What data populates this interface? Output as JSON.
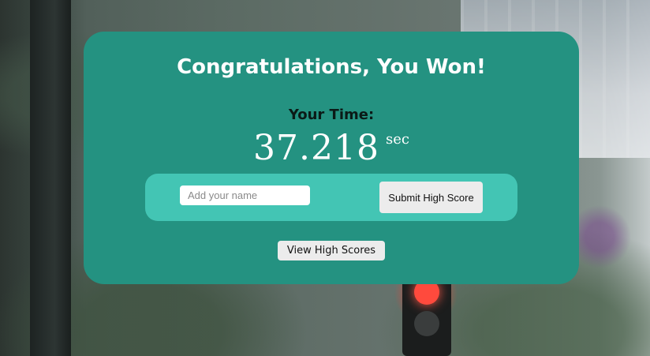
{
  "modal": {
    "title": "Congratulations, You Won!",
    "time_label": "Your Time:",
    "time_value": "37.218",
    "time_unit": "sec",
    "name_input": {
      "placeholder": "Add your name",
      "value": ""
    },
    "submit_label": "Submit High Score",
    "view_scores_label": "View High Scores"
  },
  "colors": {
    "modal_background": "#249281",
    "score_bar_background": "#43c5b4",
    "button_background": "#ececec"
  }
}
